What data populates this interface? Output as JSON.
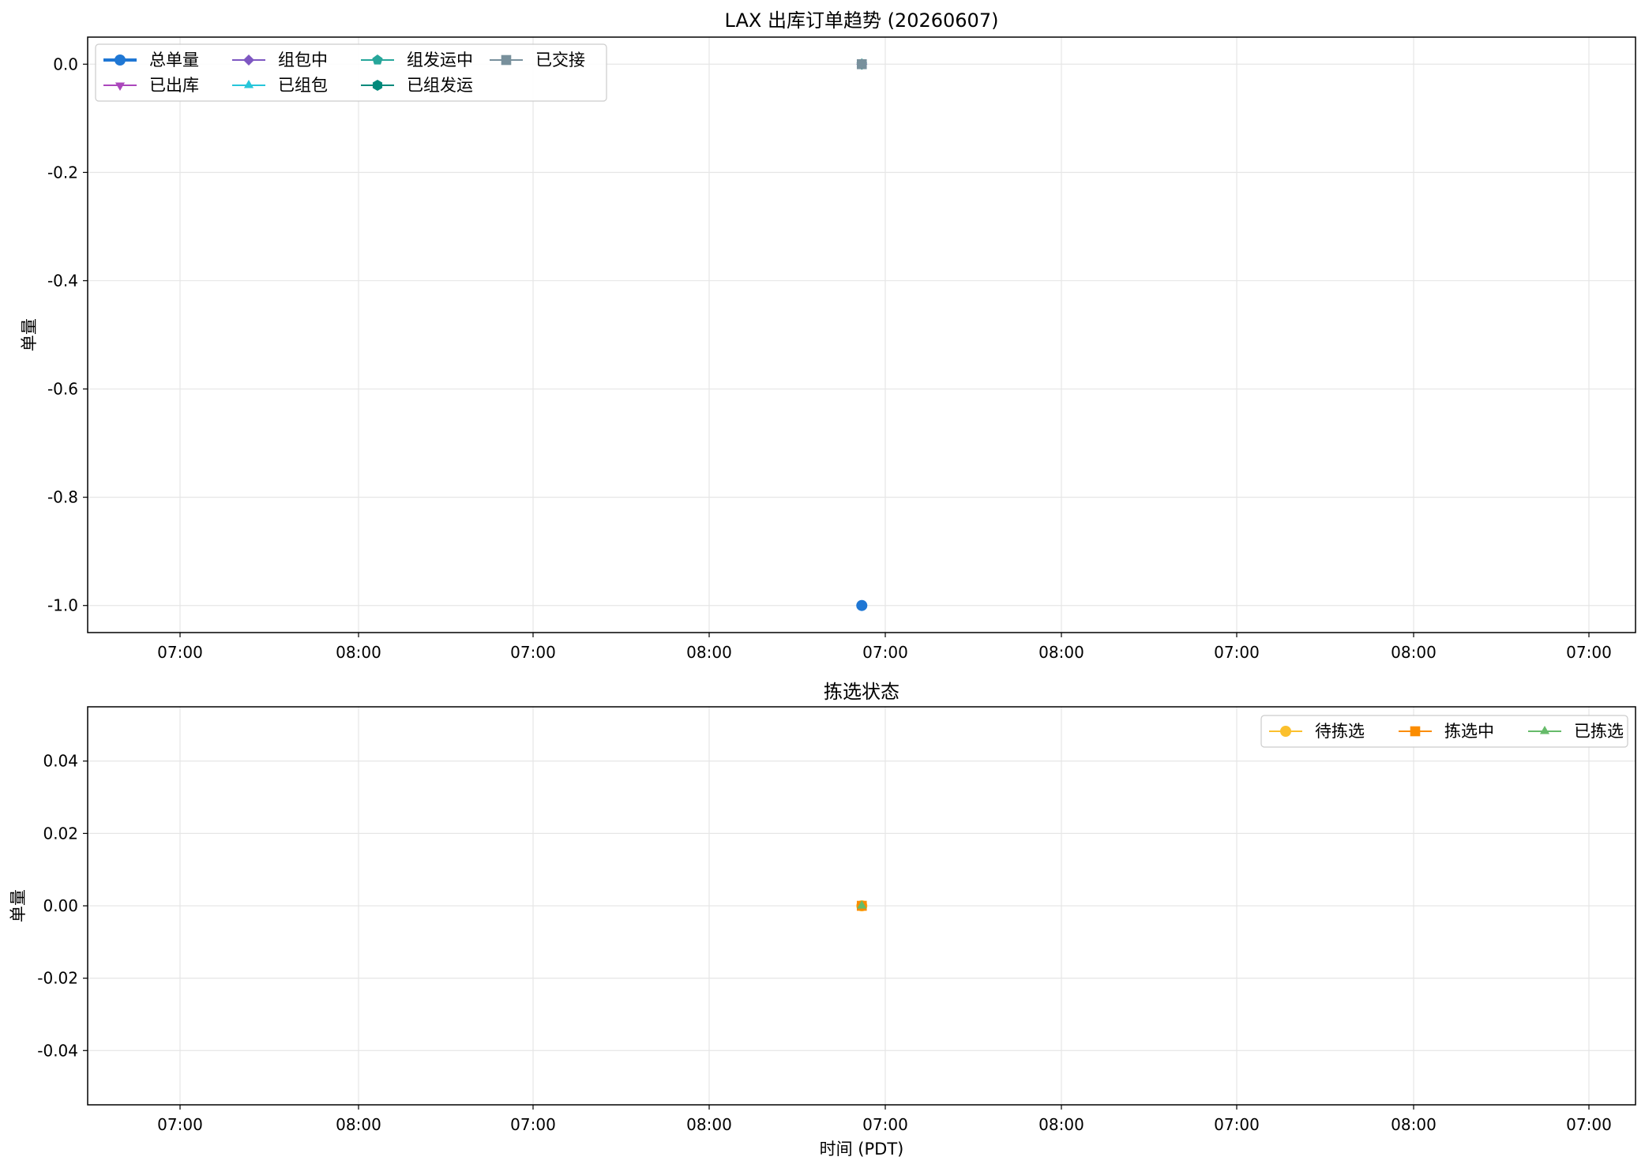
{
  "chart_data": [
    {
      "type": "line",
      "title": "LAX 出库订单趋势 (20260607)",
      "xlabel": "",
      "ylabel": "单量",
      "x_ticks": [
        "07:00",
        "08:00",
        "07:00",
        "08:00",
        "07:00",
        "08:00",
        "07:00",
        "08:00",
        "07:00"
      ],
      "y_ticks": [
        "0.0",
        "-0.2",
        "-0.4",
        "-0.6",
        "-0.8",
        "-1.0"
      ],
      "ylim": [
        -1.05,
        0.05
      ],
      "grid": true,
      "legend_placement": "upper-left",
      "legend_columns": 4,
      "series": [
        {
          "name": "总单量",
          "color": "#1f77d4",
          "marker": "circle",
          "x": [
            "06:52"
          ],
          "y": [
            -1
          ]
        },
        {
          "name": "已出库",
          "color": "#ab47bc",
          "marker": "triangle-down",
          "x": [
            "06:52"
          ],
          "y": [
            0
          ]
        },
        {
          "name": "组包中",
          "color": "#7e57c2",
          "marker": "diamond",
          "x": [
            "06:52"
          ],
          "y": [
            0
          ]
        },
        {
          "name": "已组包",
          "color": "#26c6da",
          "marker": "triangle-up",
          "x": [
            "06:52"
          ],
          "y": [
            0
          ]
        },
        {
          "name": "组发运中",
          "color": "#26a69a",
          "marker": "pentagon",
          "x": [
            "06:52"
          ],
          "y": [
            0
          ]
        },
        {
          "name": "已组发运",
          "color": "#00897b",
          "marker": "hexagon",
          "x": [
            "06:52"
          ],
          "y": [
            0
          ]
        },
        {
          "name": "已交接",
          "color": "#78909c",
          "marker": "square",
          "x": [
            "06:52"
          ],
          "y": [
            0
          ]
        }
      ]
    },
    {
      "type": "line",
      "title": "拣选状态",
      "xlabel": "时间 (PDT)",
      "ylabel": "单量",
      "x_ticks": [
        "07:00",
        "08:00",
        "07:00",
        "08:00",
        "07:00",
        "08:00",
        "07:00",
        "08:00",
        "07:00"
      ],
      "y_ticks": [
        "0.04",
        "0.02",
        "0.00",
        "-0.02",
        "-0.04"
      ],
      "ylim": [
        -0.055,
        0.055
      ],
      "grid": true,
      "legend_placement": "upper-right",
      "legend_columns": 3,
      "series": [
        {
          "name": "待拣选",
          "color": "#fbc02d",
          "marker": "circle",
          "x": [
            "06:52"
          ],
          "y": [
            0
          ]
        },
        {
          "name": "拣选中",
          "color": "#fb8c00",
          "marker": "square",
          "x": [
            "06:52"
          ],
          "y": [
            0
          ]
        },
        {
          "name": "已拣选",
          "color": "#66bb6a",
          "marker": "triangle-up",
          "x": [
            "06:52"
          ],
          "y": [
            0
          ]
        }
      ]
    }
  ]
}
